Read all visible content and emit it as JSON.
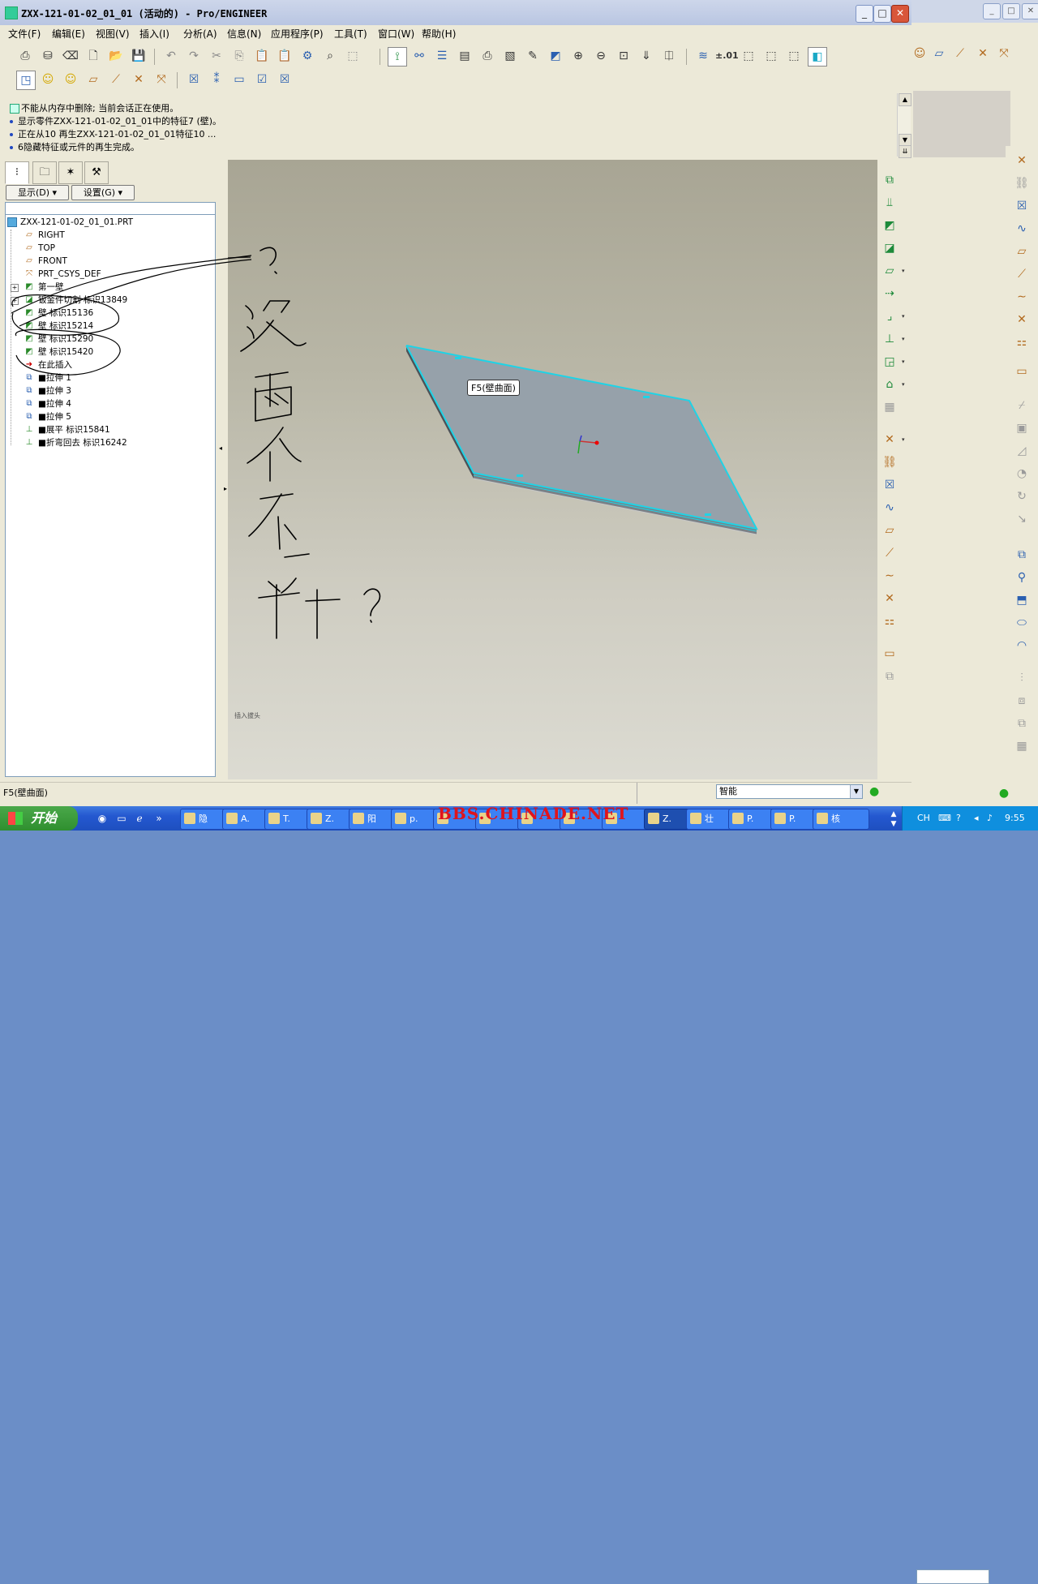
{
  "window": {
    "title": "ZXX-121-01-02_01_01 (活动的) - Pro/ENGINEER",
    "controls": {
      "minimize": "_",
      "maximize": "□",
      "close": "✕"
    }
  },
  "menu": [
    "文件(F)",
    "编辑(E)",
    "视图(V)",
    "插入(I)",
    "分析(A)",
    "信息(N)",
    "应用程序(P)",
    "工具(T)",
    "窗口(W)",
    "帮助(H)"
  ],
  "toolbar": {
    "icons": [
      "print-icon",
      "save-copy-icon",
      "erase-icon",
      "new-icon",
      "open-icon",
      "save-icon",
      "undo-icon",
      "redo-icon",
      "cut-icon",
      "copy-icon",
      "paste-icon",
      "paste-special-icon",
      "regenerate-icon",
      "find-icon",
      "select-box-icon",
      "datum-display-icon",
      "spin-center-icon",
      "layers-icon",
      "model-tree-icon",
      "print2-icon",
      "view-manager-icon",
      "repaint-icon",
      "orient-icon",
      "zoom-in-icon",
      "zoom-out-icon",
      "refit-icon",
      "saved-views-icon",
      "annotation-icon",
      "layer-icon",
      "tolerance-icon",
      "wireframe-icon",
      "hidden-line-icon",
      "no-hidden-icon",
      "shading-icon"
    ],
    "tolerance_label": "±.01"
  },
  "messages": [
    {
      "type": "warning",
      "text": "不能从内存中删除; 当前会话正在使用。"
    },
    {
      "type": "info",
      "text": "显示零件ZXX-121-01-02_01_01中的特征7 (壁)。"
    },
    {
      "type": "info",
      "text": "正在从10 再生ZXX-121-01-02_01_01特征10 ..."
    },
    {
      "type": "info",
      "text": "6隐藏特征或元件的再生完成。"
    }
  ],
  "left_panel": {
    "tabs": [
      "model-tree-tab",
      "folder-browser-tab",
      "favorites-tab",
      "connections-tab"
    ],
    "show_button": "显示(D)",
    "settings_button": "设置(G)"
  },
  "tree": {
    "root": "ZXX-121-01-02_01_01.PRT",
    "items": [
      {
        "label": "RIGHT",
        "icon": "datum-plane-icon"
      },
      {
        "label": "TOP",
        "icon": "datum-plane-icon"
      },
      {
        "label": "FRONT",
        "icon": "datum-plane-icon"
      },
      {
        "label": "PRT_CSYS_DEF",
        "icon": "csys-icon"
      },
      {
        "label": "第一壁",
        "icon": "wall-icon",
        "expandable": true
      },
      {
        "label": "钣金件切割 标识13849",
        "icon": "cut-icon",
        "expandable": true
      },
      {
        "label": "壁 标识15136",
        "icon": "wall-icon"
      },
      {
        "label": "壁 标识15214",
        "icon": "wall-icon"
      },
      {
        "label": "壁 标识15290",
        "icon": "wall-icon"
      },
      {
        "label": "壁 标识15420",
        "icon": "wall-icon"
      },
      {
        "label": "在此插入",
        "icon": "insert-here-icon"
      },
      {
        "label": "■拉伸 1",
        "icon": "extrude-icon"
      },
      {
        "label": "■拉伸 3",
        "icon": "extrude-icon"
      },
      {
        "label": "■拉伸 4",
        "icon": "extrude-icon"
      },
      {
        "label": "■拉伸 5",
        "icon": "extrude-icon"
      },
      {
        "label": "■展平 标识15841",
        "icon": "unbend-icon"
      },
      {
        "label": "■折弯回去 标识16242",
        "icon": "bendback-icon"
      }
    ]
  },
  "viewport": {
    "tooltip": "F5(壁曲面)",
    "corner_label": "插入拔头",
    "annotation_handwriting": "?这两个不一样?"
  },
  "status": {
    "text": "F5(壁曲面)",
    "filter": "智能"
  },
  "colors": {
    "part_face": "#96a1aa",
    "part_edge": "#1fd3e6",
    "part_side": "#4c5258",
    "annotation_ink": "#000000"
  },
  "taskbar": {
    "start": "开始",
    "tasks": [
      "隐",
      "A.",
      "T.",
      "Z.",
      "阳",
      "p.",
      "",
      "",
      "",
      "",
      "",
      "Z.",
      "壮",
      "P.",
      "P.",
      "核"
    ],
    "watermark": "BBS.CHINADE.NET",
    "tray_lang": "CH",
    "clock": "9:55"
  }
}
